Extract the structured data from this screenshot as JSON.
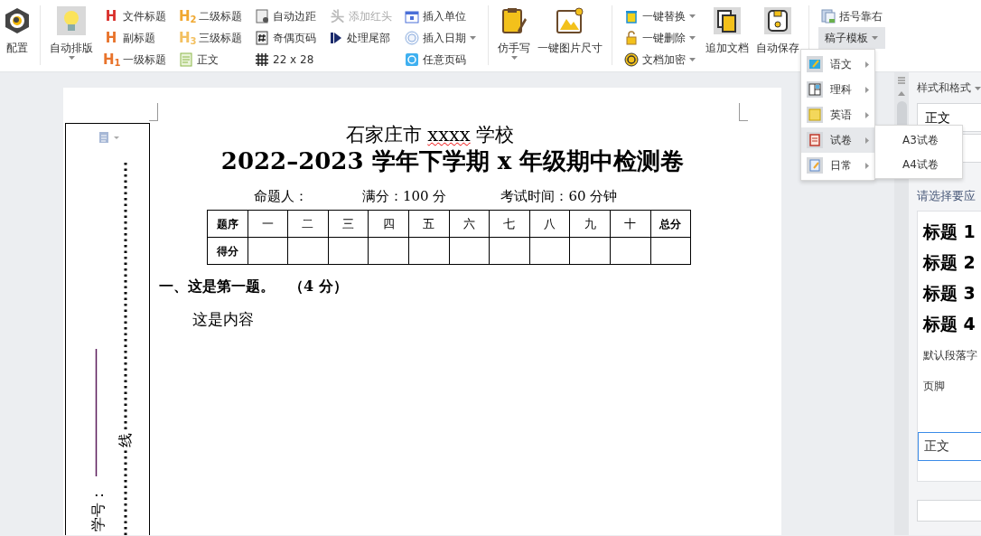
{
  "ribbon": [
    {
      "kind": "large",
      "label": "配置",
      "dropdown": false
    },
    {
      "kind": "separator"
    },
    {
      "kind": "large",
      "label": "自动排版",
      "dropdown": true
    },
    {
      "kind": "stack",
      "items": [
        {
          "label": "文件标题",
          "glyph": "H",
          "dropdown": false,
          "disabled": false,
          "expanded": false
        },
        {
          "label": "副标题",
          "glyph": "H",
          "dropdown": false,
          "disabled": false,
          "expanded": false
        },
        {
          "label": "一级标题",
          "glyph": "H$_{1}$",
          "dropdown": false,
          "disabled": false,
          "expanded": false
        }
      ]
    },
    {
      "kind": "stack",
      "items": [
        {
          "label": "二级标题",
          "glyph": "H$_{2}$",
          "dropdown": false,
          "disabled": false,
          "expanded": false
        },
        {
          "label": "三级标题",
          "glyph": "H$_{3}$",
          "dropdown": false,
          "disabled": false,
          "expanded": false
        },
        {
          "label": "正文",
          "dropdown": false,
          "disabled": false,
          "expanded": false
        }
      ]
    },
    {
      "kind": "stack",
      "items": [
        {
          "label": "自动边距",
          "dropdown": false,
          "disabled": false,
          "expanded": false
        },
        {
          "label": "奇偶页码",
          "dropdown": false,
          "disabled": false,
          "expanded": false
        },
        {
          "label": "22 x 28",
          "dropdown": false,
          "disabled": false,
          "expanded": false
        }
      ]
    },
    {
      "kind": "stack",
      "items": [
        {
          "label": "添加红头",
          "glyph": "头",
          "dropdown": false,
          "disabled": true,
          "expanded": false
        },
        {
          "label": "处理尾部",
          "dropdown": false,
          "disabled": false,
          "expanded": false
        }
      ]
    },
    {
      "kind": "stack",
      "items": [
        {
          "label": "插入单位",
          "dropdown": false,
          "disabled": false,
          "expanded": false
        },
        {
          "label": "插入日期",
          "dropdown": true,
          "disabled": false,
          "expanded": false
        },
        {
          "label": "任意页码",
          "dropdown": false,
          "disabled": false,
          "expanded": false
        }
      ]
    },
    {
      "kind": "separator"
    },
    {
      "kind": "large",
      "label": "仿手写",
      "dropdown": true
    },
    {
      "kind": "large",
      "label": "一键图片尺寸",
      "dropdown": false
    },
    {
      "kind": "separator"
    },
    {
      "kind": "stack",
      "items": [
        {
          "label": "一键替换",
          "dropdown": true,
          "disabled": false,
          "expanded": false
        },
        {
          "label": "一键删除",
          "dropdown": true,
          "disabled": false,
          "expanded": false
        },
        {
          "label": "文档加密",
          "dropdown": true,
          "disabled": false,
          "expanded": false
        }
      ]
    },
    {
      "kind": "large",
      "label": "追加文档",
      "dropdown": false
    },
    {
      "kind": "large",
      "label": "自动保存",
      "dropdown": false
    },
    {
      "kind": "separator"
    },
    {
      "kind": "stack",
      "items": [
        {
          "label": "括号靠右",
          "dropdown": false,
          "disabled": false,
          "expanded": false
        },
        {
          "label": "稿子模板",
          "dropdown": true,
          "disabled": false,
          "expanded": true
        }
      ]
    }
  ],
  "menu": [
    {
      "label": "语文",
      "selected": false
    },
    {
      "label": "理科",
      "selected": false
    },
    {
      "label": "英语",
      "selected": false
    },
    {
      "label": "试卷",
      "selected": true
    },
    {
      "label": "日常",
      "selected": false
    }
  ],
  "submenu": [
    {
      "label": "A3试卷"
    },
    {
      "label": "A4试卷"
    }
  ],
  "document": {
    "title_segments": [
      {
        "text": "石家庄市 ",
        "flagged": false
      },
      {
        "text": "xxxx",
        "flagged": true
      },
      {
        "text": " 学校",
        "flagged": false
      }
    ],
    "heading": "2022–2023 学年下学期 x 年级期中检测卷",
    "info": [
      "命题人：",
      "满分：100 分",
      "考试时间：60 分钟"
    ],
    "score_table": {
      "rows": [
        [
          "题序",
          "一",
          "二",
          "三",
          "四",
          "五",
          "六",
          "七",
          "八",
          "九",
          "十",
          "总分"
        ],
        [
          "得分"
        ]
      ]
    },
    "question": "一、这是第一题。　（4 分）",
    "content": "这是内容",
    "binding": {
      "line_label": "线",
      "student_id_label": "学号："
    }
  },
  "styles_panel": {
    "title": "样式和格式",
    "current_style": "正文",
    "hint": "请选择要应",
    "styles": [
      {
        "label": "标题 1",
        "kind": "heading",
        "selected": false
      },
      {
        "label": "标题 2",
        "kind": "heading",
        "selected": false
      },
      {
        "label": "标题 3",
        "kind": "heading",
        "selected": false
      },
      {
        "label": "标题 4",
        "kind": "heading",
        "selected": false
      },
      {
        "label": "默认段落字",
        "kind": "plain",
        "selected": false
      },
      {
        "label": "页脚",
        "kind": "plain",
        "selected": false
      },
      {
        "label": "正文",
        "kind": "plain",
        "selected": true
      }
    ]
  }
}
